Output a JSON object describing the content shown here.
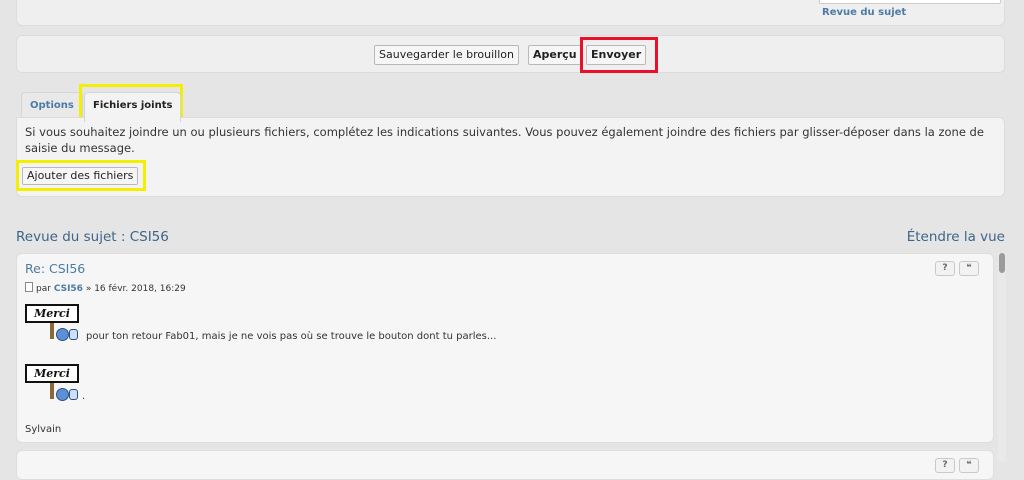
{
  "top": {
    "review_link": "Revue du sujet"
  },
  "buttons": {
    "save_draft": "Sauvegarder le brouillon",
    "preview": "Aperçu",
    "submit": "Envoyer"
  },
  "tabs": [
    {
      "label": "Options"
    },
    {
      "label": "Fichiers joints"
    }
  ],
  "attachments": {
    "description": "Si vous souhaitez joindre un ou plusieurs fichiers, complétez les indications suivantes. Vous pouvez également joindre des fichiers par glisser-déposer dans la zone de saisie du message.",
    "add_button": "Ajouter des fichiers"
  },
  "review": {
    "title": "Revue du sujet : CSI56",
    "expand_link": "Étendre la vue"
  },
  "post": {
    "title": "Re: CSI56",
    "by": "par",
    "author": "CSI56",
    "date": "» 16 févr. 2018, 16:29",
    "sign_text": "Merci",
    "message_line1": "pour ton retour Fab01, mais je ne vois pas où se trouve le bouton dont tu parles...",
    "message_line2": ".",
    "signature": "Sylvain",
    "report_btn": "?",
    "quote_btn": "❝"
  },
  "highlight_colors": {
    "red": "#e8102a",
    "yellow": "#f4ee00"
  }
}
